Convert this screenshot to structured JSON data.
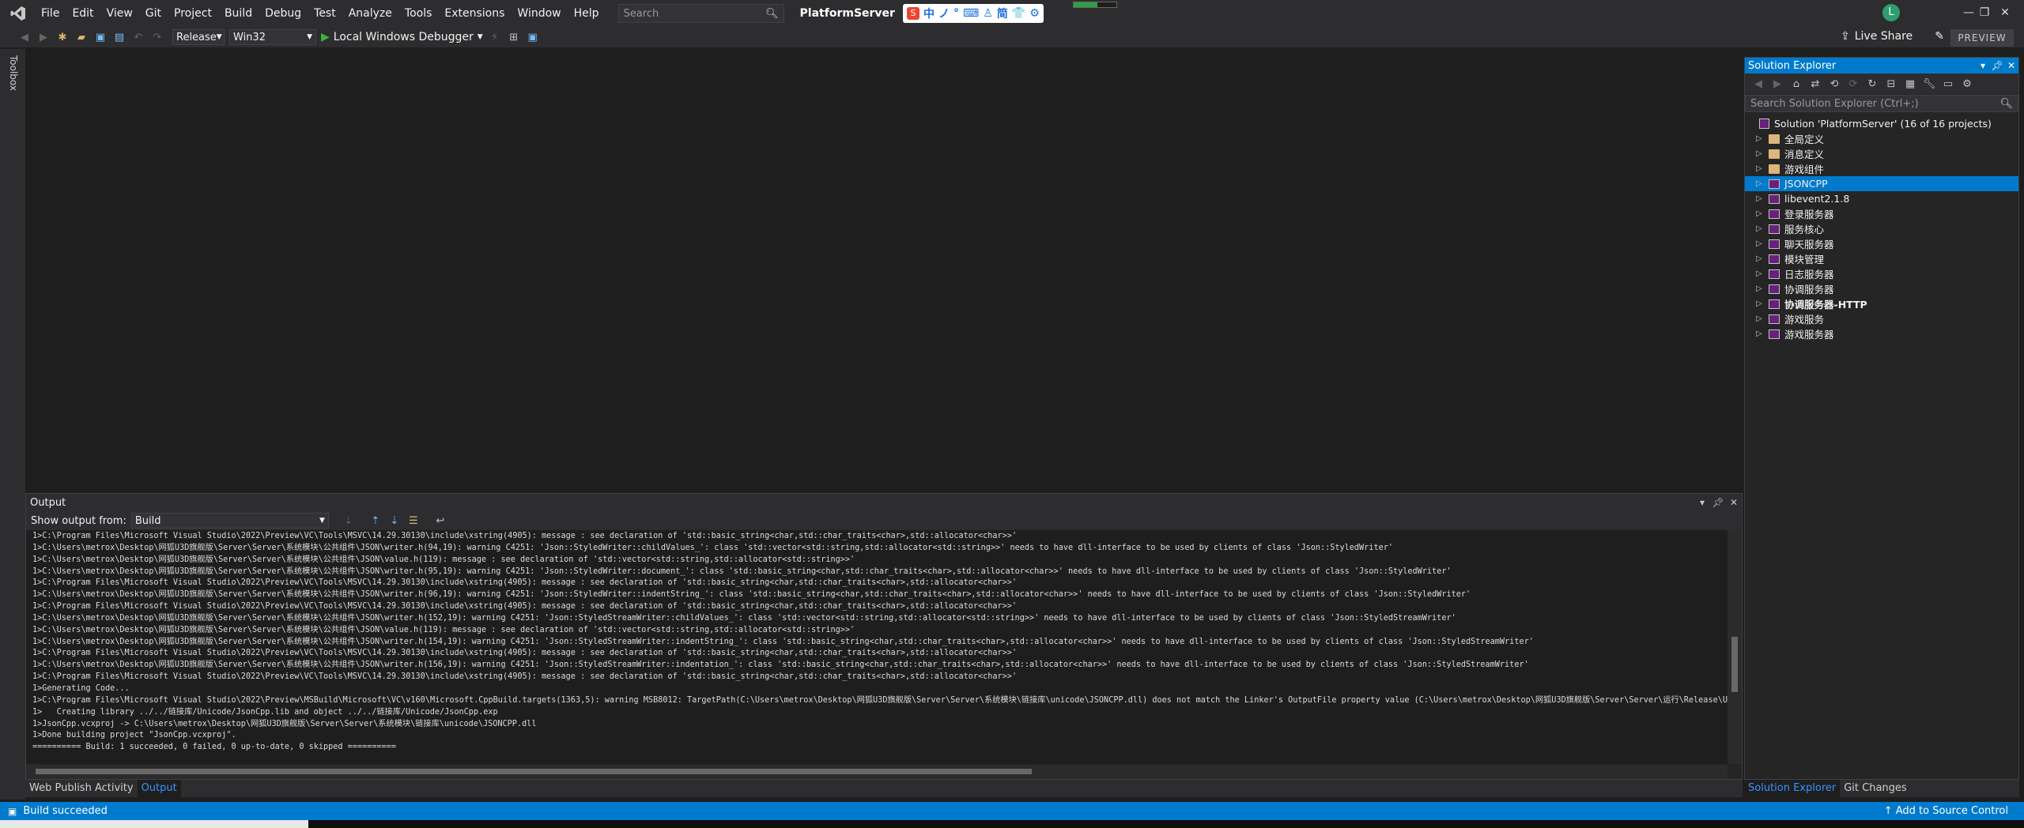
{
  "menu": {
    "items": [
      "File",
      "Edit",
      "View",
      "Git",
      "Project",
      "Build",
      "Debug",
      "Test",
      "Analyze",
      "Tools",
      "Extensions",
      "Window",
      "Help"
    ],
    "search_placeholder": "Search",
    "solution_name": "PlatformServer"
  },
  "ime": {
    "items": [
      "中",
      "ノ",
      "°",
      "⌨",
      "♙",
      "简",
      "👕",
      "⚙"
    ]
  },
  "account": {
    "initial": "L"
  },
  "window_controls": {
    "minimize": "—",
    "restore": "❐",
    "close": "✕"
  },
  "toolbar": {
    "config": "Release",
    "platform": "Win32",
    "debugger": "Local Windows Debugger",
    "live_share": "Live Share",
    "preview": "PREVIEW"
  },
  "toolbox": {
    "label": "Toolbox"
  },
  "output": {
    "title": "Output",
    "show_from_label": "Show output from:",
    "source": "Build",
    "lines": [
      "1>C:\\Program Files\\Microsoft Visual Studio\\2022\\Preview\\VC\\Tools\\MSVC\\14.29.30130\\include\\xstring(4905): message : see declaration of 'std::basic_string<char,std::char_traits<char>,std::allocator<char>>'",
      "1>C:\\Users\\metrox\\Desktop\\网狐U3D旗舰版\\Server\\Server\\系统模块\\公共组件\\JSON\\writer.h(94,19): warning C4251: 'Json::StyledWriter::childValues_': class 'std::vector<std::string,std::allocator<std::string>>' needs to have dll-interface to be used by clients of class 'Json::StyledWriter'",
      "1>C:\\Users\\metrox\\Desktop\\网狐U3D旗舰版\\Server\\Server\\系统模块\\公共组件\\JSON\\value.h(119): message : see declaration of 'std::vector<std::string,std::allocator<std::string>>'",
      "1>C:\\Users\\metrox\\Desktop\\网狐U3D旗舰版\\Server\\Server\\系统模块\\公共组件\\JSON\\writer.h(95,19): warning C4251: 'Json::StyledWriter::document_': class 'std::basic_string<char,std::char_traits<char>,std::allocator<char>>' needs to have dll-interface to be used by clients of class 'Json::StyledWriter'",
      "1>C:\\Program Files\\Microsoft Visual Studio\\2022\\Preview\\VC\\Tools\\MSVC\\14.29.30130\\include\\xstring(4905): message : see declaration of 'std::basic_string<char,std::char_traits<char>,std::allocator<char>>'",
      "1>C:\\Users\\metrox\\Desktop\\网狐U3D旗舰版\\Server\\Server\\系统模块\\公共组件\\JSON\\writer.h(96,19): warning C4251: 'Json::StyledWriter::indentString_': class 'std::basic_string<char,std::char_traits<char>,std::allocator<char>>' needs to have dll-interface to be used by clients of class 'Json::StyledWriter'",
      "1>C:\\Program Files\\Microsoft Visual Studio\\2022\\Preview\\VC\\Tools\\MSVC\\14.29.30130\\include\\xstring(4905): message : see declaration of 'std::basic_string<char,std::char_traits<char>,std::allocator<char>>'",
      "1>C:\\Users\\metrox\\Desktop\\网狐U3D旗舰版\\Server\\Server\\系统模块\\公共组件\\JSON\\writer.h(152,19): warning C4251: 'Json::StyledStreamWriter::childValues_': class 'std::vector<std::string,std::allocator<std::string>>' needs to have dll-interface to be used by clients of class 'Json::StyledStreamWriter'",
      "1>C:\\Users\\metrox\\Desktop\\网狐U3D旗舰版\\Server\\Server\\系统模块\\公共组件\\JSON\\value.h(119): message : see declaration of 'std::vector<std::string,std::allocator<std::string>>'",
      "1>C:\\Users\\metrox\\Desktop\\网狐U3D旗舰版\\Server\\Server\\系统模块\\公共组件\\JSON\\writer.h(154,19): warning C4251: 'Json::StyledStreamWriter::indentString_': class 'std::basic_string<char,std::char_traits<char>,std::allocator<char>>' needs to have dll-interface to be used by clients of class 'Json::StyledStreamWriter'",
      "1>C:\\Program Files\\Microsoft Visual Studio\\2022\\Preview\\VC\\Tools\\MSVC\\14.29.30130\\include\\xstring(4905): message : see declaration of 'std::basic_string<char,std::char_traits<char>,std::allocator<char>>'",
      "1>C:\\Users\\metrox\\Desktop\\网狐U3D旗舰版\\Server\\Server\\系统模块\\公共组件\\JSON\\writer.h(156,19): warning C4251: 'Json::StyledStreamWriter::indentation_': class 'std::basic_string<char,std::char_traits<char>,std::allocator<char>>' needs to have dll-interface to be used by clients of class 'Json::StyledStreamWriter'",
      "1>C:\\Program Files\\Microsoft Visual Studio\\2022\\Preview\\VC\\Tools\\MSVC\\14.29.30130\\include\\xstring(4905): message : see declaration of 'std::basic_string<char,std::char_traits<char>,std::allocator<char>>'",
      "1>Generating Code...",
      "1>C:\\Program Files\\Microsoft Visual Studio\\2022\\Preview\\MSBuild\\Microsoft\\VC\\v160\\Microsoft.CppBuild.targets(1363,5): warning MSB8012: TargetPath(C:\\Users\\metrox\\Desktop\\网狐U3D旗舰版\\Server\\Server\\系统模块\\链接库\\unicode\\JSONCPP.dll) does not match the Linker's OutputFile property value (C:\\Users\\metrox\\Desktop\\网狐U3D旗舰版\\Server\\Server\\运行\\Release\\U",
      "1>   Creating library ../../链接库/Unicode/JsonCpp.lib and object ../../链接库/Unicode/JsonCpp.exp",
      "1>JsonCpp.vcxproj -> C:\\Users\\metrox\\Desktop\\网狐U3D旗舰版\\Server\\Server\\系统模块\\链接库\\unicode\\JSONCPP.dll",
      "1>Done building project \"JsonCpp.vcxproj\".",
      "========== Build: 1 succeeded, 0 failed, 0 up-to-date, 0 skipped =========="
    ]
  },
  "bottom_tabs": [
    "Web Publish Activity",
    "Output"
  ],
  "solution_explorer": {
    "title": "Solution Explorer",
    "search_placeholder": "Search Solution Explorer (Ctrl+;)",
    "root": "Solution 'PlatformServer' (16 of 16 projects)",
    "items": [
      {
        "label": "全局定义",
        "type": "folder"
      },
      {
        "label": "消息定义",
        "type": "folder"
      },
      {
        "label": "游戏组件",
        "type": "folder"
      },
      {
        "label": "JSONCPP",
        "type": "project",
        "selected": true
      },
      {
        "label": "libevent2.1.8",
        "type": "project"
      },
      {
        "label": "登录服务器",
        "type": "project"
      },
      {
        "label": "服务核心",
        "type": "project"
      },
      {
        "label": "聊天服务器",
        "type": "project"
      },
      {
        "label": "模块管理",
        "type": "project"
      },
      {
        "label": "日志服务器",
        "type": "project"
      },
      {
        "label": "协调服务器",
        "type": "project"
      },
      {
        "label": "协调服务器-HTTP",
        "type": "project",
        "bold": true
      },
      {
        "label": "游戏服务",
        "type": "project"
      },
      {
        "label": "游戏服务器",
        "type": "project"
      }
    ],
    "tabs": [
      "Solution Explorer",
      "Git Changes"
    ]
  },
  "status": {
    "message": "Build succeeded",
    "right_text": "Add to Source Control"
  }
}
